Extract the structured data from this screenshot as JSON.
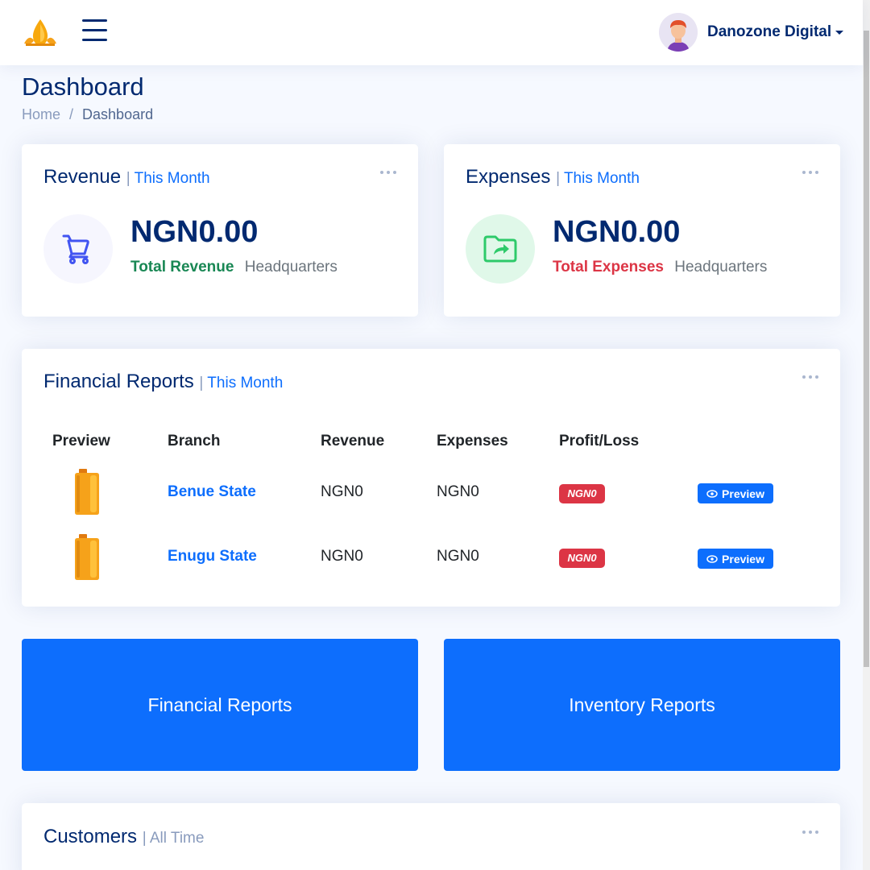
{
  "header": {
    "logo_icon": "oil-drop-logo-icon",
    "menu_icon": "hamburger-menu-icon",
    "user_name": "Danozone Digital"
  },
  "page": {
    "title": "Dashboard",
    "breadcrumb": [
      "Home",
      "/",
      "Dashboard"
    ]
  },
  "revenue_card": {
    "title": "Revenue",
    "period": "This Month",
    "value": "NGN0.00",
    "label": "Total Revenue",
    "location": "Headquarters",
    "icon": "cart-icon"
  },
  "expenses_card": {
    "title": "Expenses",
    "period": "This Month",
    "value": "NGN0.00",
    "label": "Total Expenses",
    "location": "Headquarters",
    "icon": "folder-share-icon"
  },
  "financial_reports": {
    "title": "Financial Reports",
    "period": "This Month",
    "columns": [
      "Preview",
      "Branch",
      "Revenue",
      "Expenses",
      "Profit/Loss"
    ],
    "rows": [
      {
        "branch": "Benue State",
        "revenue": "NGN0",
        "expenses": "NGN0",
        "profit_loss": "NGN0",
        "action": "Preview"
      },
      {
        "branch": "Enugu State",
        "revenue": "NGN0",
        "expenses": "NGN0",
        "profit_loss": "NGN0",
        "action": "Preview"
      }
    ]
  },
  "buttons": {
    "financial_reports": "Financial Reports",
    "inventory_reports": "Inventory Reports"
  },
  "customers_card": {
    "title": "Customers",
    "period": "All Time"
  },
  "colors": {
    "primary": "#0d6efd",
    "navy": "#012970",
    "success": "#198754",
    "danger": "#dc3545",
    "background": "#f6f9ff"
  }
}
